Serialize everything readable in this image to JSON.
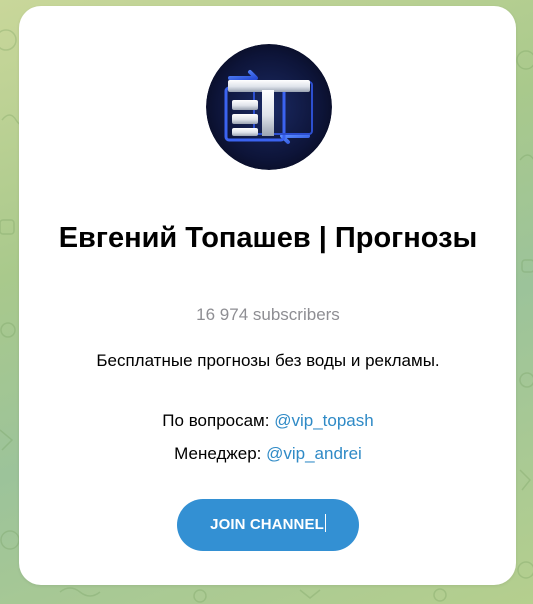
{
  "channel": {
    "title": "Евгений Топашев | Прогнозы",
    "subscribers": "16 974 subscribers",
    "description": "Бесплатные прогнозы без воды и рекламы.",
    "contacts": [
      {
        "label": "По вопросам:",
        "handle": "@vip_topash"
      },
      {
        "label": "Менеджер:",
        "handle": "@vip_andrei"
      }
    ],
    "join_label": "JOIN CHANNEL"
  },
  "icons": {
    "avatar": "channel-logo-et-icon"
  },
  "colors": {
    "link": "#2f8ac6",
    "button": "#3390d3",
    "subtext": "#8e8e93",
    "background": "#a9c98c"
  }
}
